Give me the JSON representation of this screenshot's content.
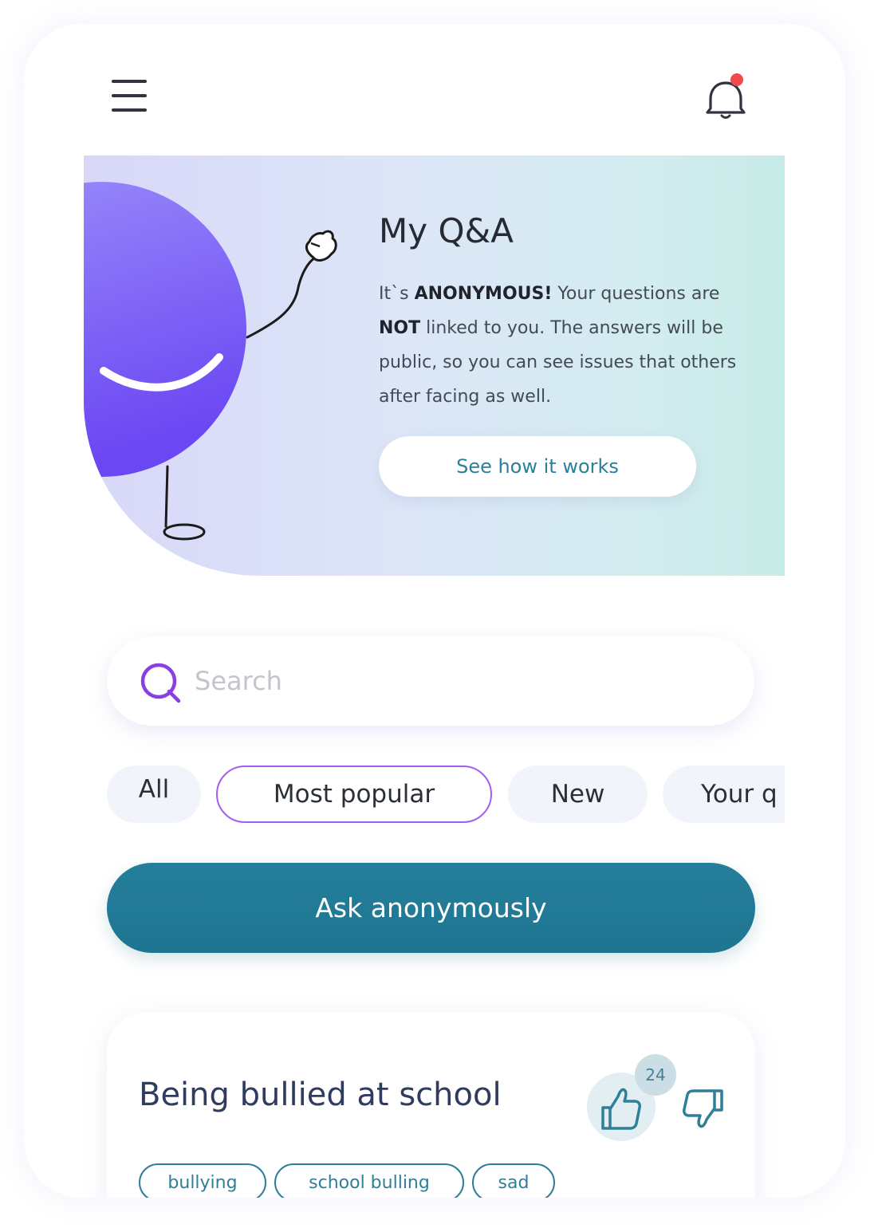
{
  "header": {
    "menu_icon": "hamburger-menu-icon",
    "notification_icon": "bell-icon",
    "has_unread_notification": true
  },
  "hero": {
    "title": "My Q&A",
    "description_parts": {
      "p1": "It`s ",
      "b1": "ANONYMOUS!",
      "p2": " Your questions are ",
      "b2": "NOT",
      "p3": " linked to you. The answers will be public, so you can see issues that others after facing as well."
    },
    "button_label": "See how it works"
  },
  "search": {
    "placeholder": "Search",
    "value": "",
    "icon": "search-icon"
  },
  "filters": {
    "items": [
      {
        "label": "All",
        "active": false
      },
      {
        "label": "Most popular",
        "active": true
      },
      {
        "label": "New",
        "active": false
      },
      {
        "label": "Your q",
        "active": false
      }
    ]
  },
  "ask_button_label": "Ask anonymously",
  "question_card": {
    "title": "Being bullied at school",
    "likes": "24",
    "tags": [
      "bullying",
      "school bulling",
      "sad"
    ]
  },
  "colors": {
    "accent_purple": "#a35df0",
    "primary_teal": "#1f7893",
    "notification_dot": "#f14a4a",
    "mascot_purple": "#7f62f7"
  }
}
